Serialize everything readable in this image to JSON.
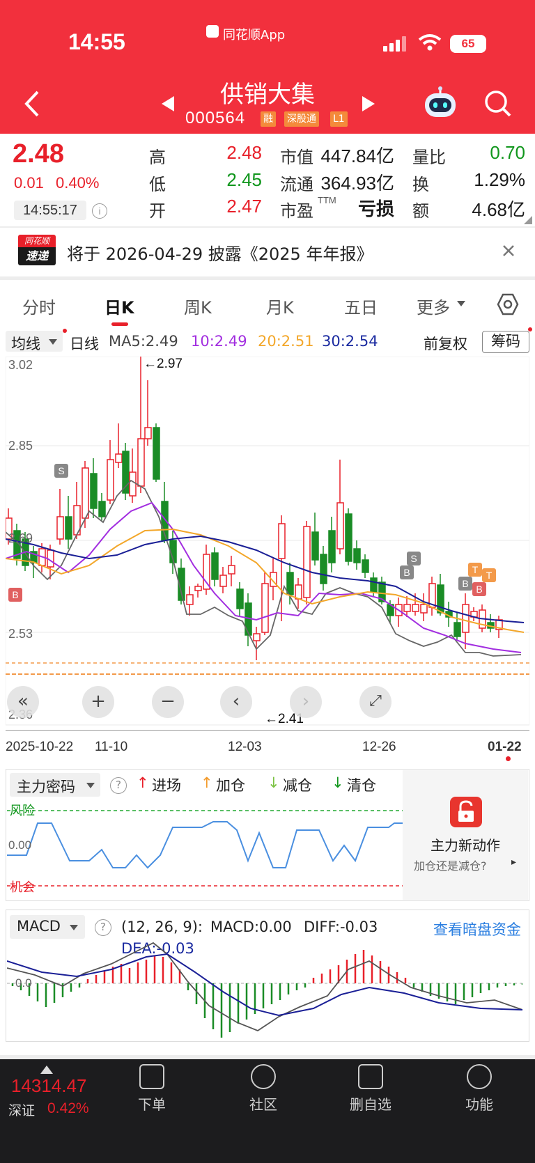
{
  "statusbar": {
    "time": "14:55",
    "app": "同花顺App",
    "battery": "65"
  },
  "stock": {
    "name": "供销大集",
    "code": "000564",
    "tags": [
      "融",
      "深股通",
      "L1"
    ]
  },
  "quote": {
    "price": "2.48",
    "change": "0.01",
    "change_pct": "0.40%",
    "time": "14:55:17",
    "high_label": "高",
    "high": "2.48",
    "low_label": "低",
    "low": "2.45",
    "open_label": "开",
    "open": "2.47",
    "mktcap_label": "市值",
    "mktcap": "447.84亿",
    "float_label": "流通",
    "float": "364.93亿",
    "pe_label": "市盈",
    "pe_sup": "TTM",
    "pe": "亏损",
    "volratio_label": "量比",
    "volratio": "0.70",
    "turnover_label": "换",
    "turnover": "1.29%",
    "amount_label": "额",
    "amount": "4.68亿"
  },
  "notice": {
    "logo_top": "同花顺",
    "logo_bottom": "速递",
    "text": "将于 2026-04-29 披露《2025 年年报》"
  },
  "tabs": [
    "分时",
    "日K",
    "周K",
    "月K",
    "五日",
    "更多"
  ],
  "ma_bar": {
    "selector": "均线",
    "period": "日线",
    "ma5": "MA5:2.49",
    "ma10": "10:2.49",
    "ma20": "20:2.51",
    "ma30": "30:2.54",
    "adjust": "前复权",
    "chips": "筹码"
  },
  "kline": {
    "y_labels": [
      "3.02",
      "2.85",
      "2.69",
      "2.53",
      "2.36"
    ],
    "x_labels": [
      "2025-10-22",
      "11-10",
      "12-03",
      "12-26",
      "01-22"
    ],
    "high_note": "←2.97",
    "low_note": "←2.41",
    "markers": [
      "S",
      "B",
      "S",
      "B",
      "B",
      "T",
      "T",
      "B"
    ]
  },
  "signal": {
    "selector": "主力密码",
    "legend": [
      "进场",
      "加仓",
      "减仓",
      "清仓"
    ],
    "risk": "风险",
    "zero": "0.00",
    "chance": "机会",
    "promo_title": "主力新动作",
    "promo_sub": "加仓还是减仓?"
  },
  "macd": {
    "selector": "MACD",
    "params": "(12, 26, 9):",
    "macd": "MACD:0.00",
    "diff": "DIFF:-0.03",
    "dea": "DEA:-0.03",
    "zero": "0.0",
    "link": "查看暗盘资金"
  },
  "bottom": {
    "index_value": "14314.47",
    "index_name": "深证",
    "index_pct": "0.42%",
    "nav": [
      "下单",
      "社区",
      "删自选",
      "功能"
    ]
  },
  "colors": {
    "header": "#f2303d",
    "up": "#e8202a",
    "down": "#10961c"
  }
}
